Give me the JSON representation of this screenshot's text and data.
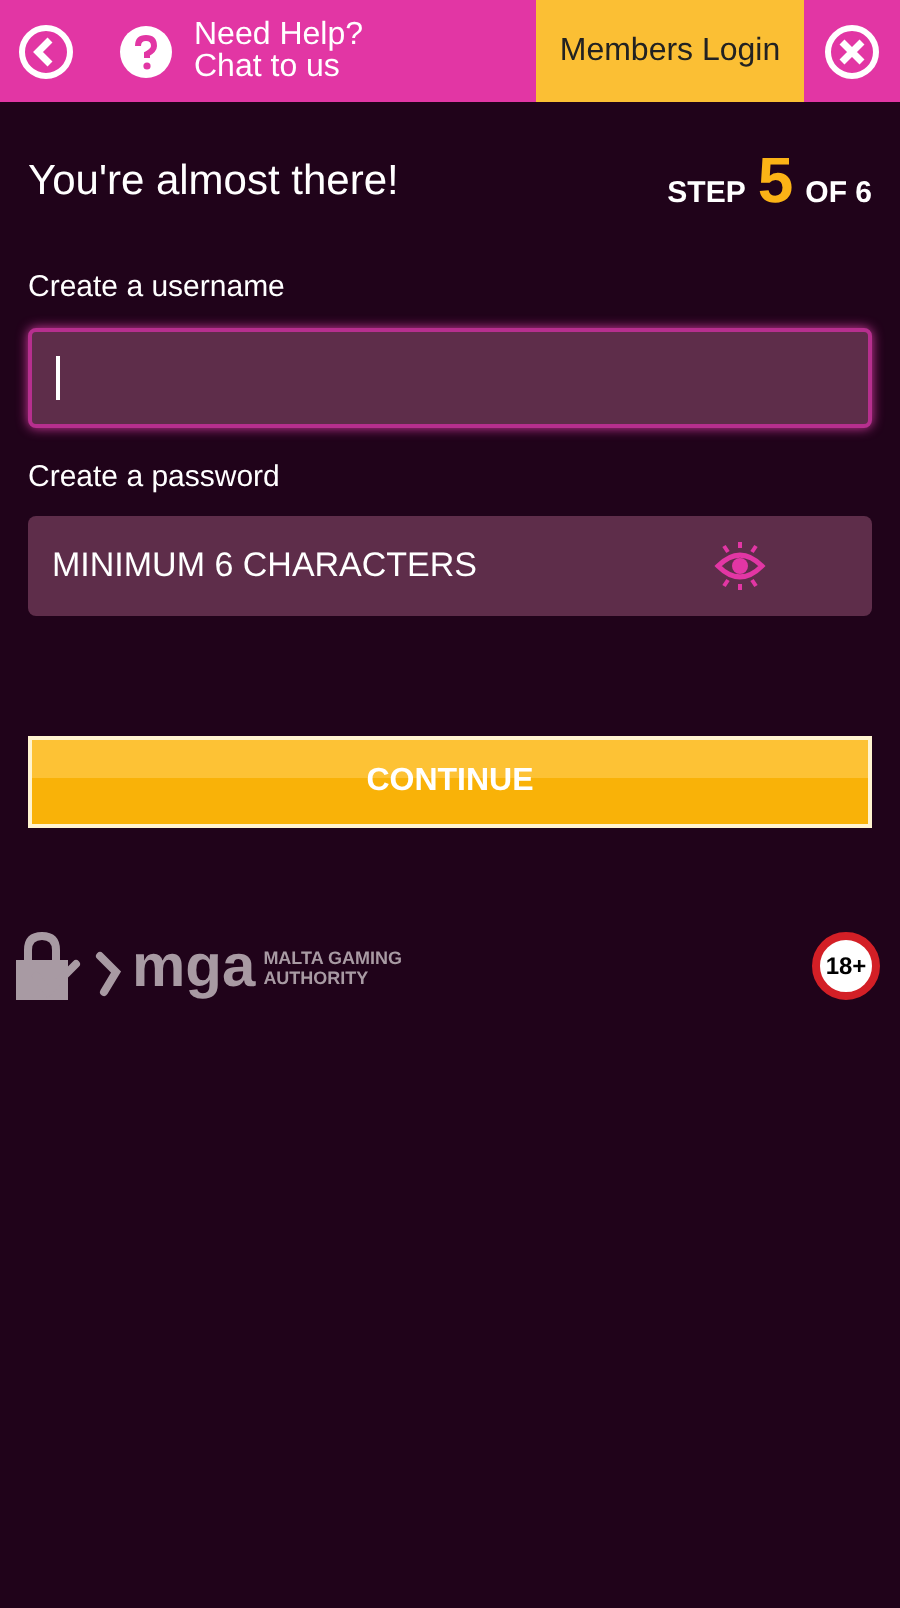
{
  "header": {
    "help_lines": [
      "Need Help?",
      "Chat to us"
    ],
    "members_login": "Members Login"
  },
  "heading": "You're almost there!",
  "step": {
    "prefix": "STEP",
    "current": "5",
    "suffix": "OF 6"
  },
  "fields": [
    {
      "label": "Create a username",
      "focused": true,
      "kind": "text"
    },
    {
      "label": "Create a password",
      "placeholder": "MINIMUM 6 CHARACTERS",
      "focused": false,
      "kind": "password"
    }
  ],
  "continue_button": "CONTINUE",
  "footer": {
    "regulator_mark": "mga",
    "regulator_lines": [
      "MALTA GAMING",
      "AUTHORITY"
    ],
    "age_badge": "18+"
  }
}
